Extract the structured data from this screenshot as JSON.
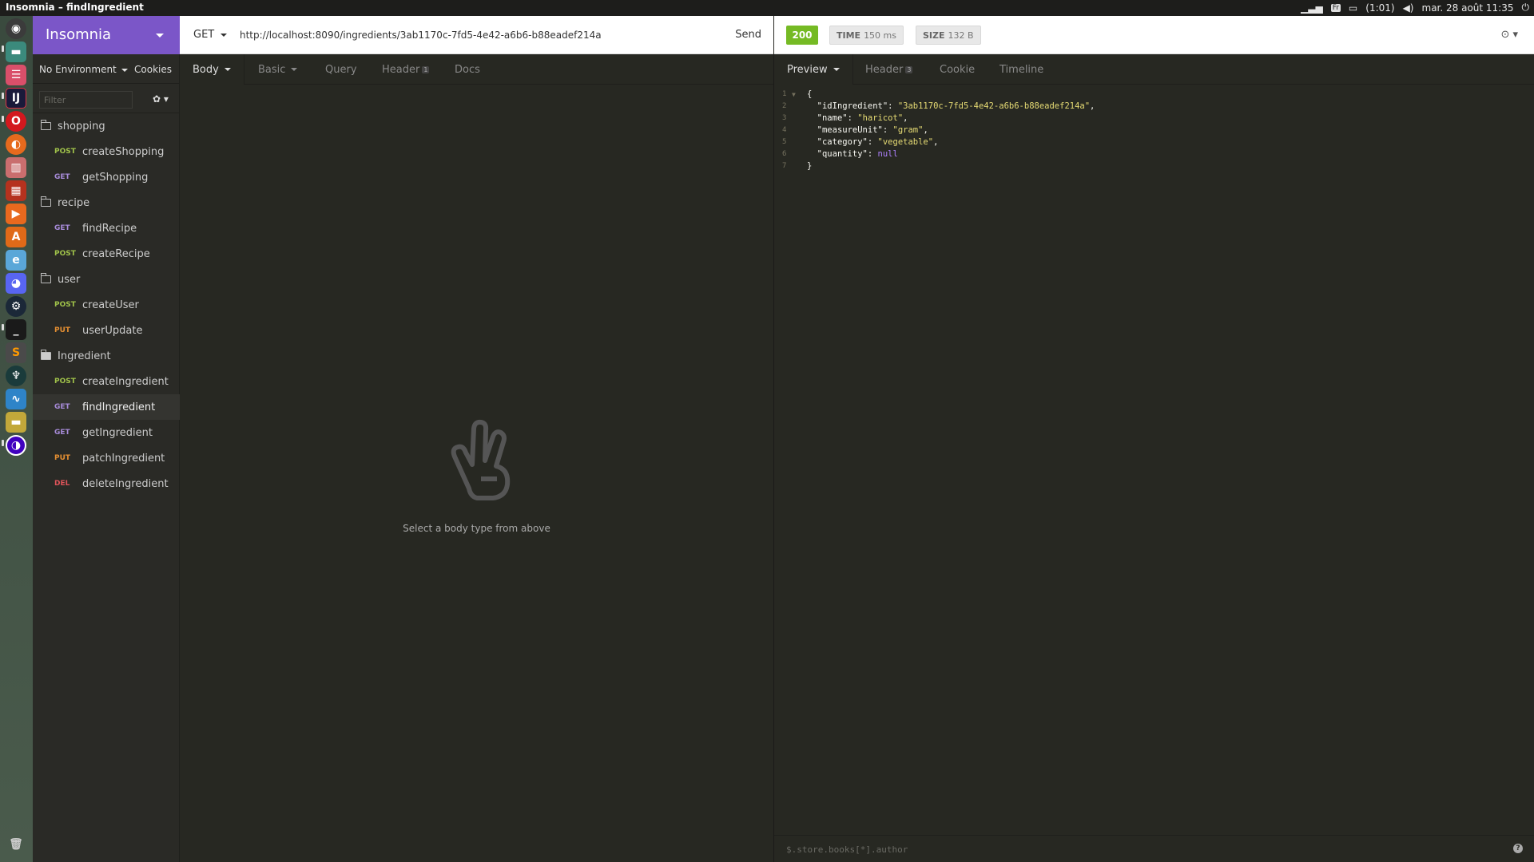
{
  "os": {
    "window_title": "Insomnia – findIngredient",
    "keyboard_layout": "Fr",
    "battery": "(1:01)",
    "datetime": "mar. 28 août 11:35"
  },
  "workspace": {
    "name": "Insomnia",
    "environment": "No Environment",
    "cookies_label": "Cookies",
    "filter_placeholder": "Filter"
  },
  "sidebar": {
    "groups": [
      {
        "name": "shopping",
        "items": [
          {
            "method": "POST",
            "name": "createShopping"
          },
          {
            "method": "GET",
            "name": "getShopping"
          }
        ]
      },
      {
        "name": "recipe",
        "items": [
          {
            "method": "GET",
            "name": "findRecipe"
          },
          {
            "method": "POST",
            "name": "createRecipe"
          }
        ]
      },
      {
        "name": "user",
        "items": [
          {
            "method": "POST",
            "name": "createUser"
          },
          {
            "method": "PUT",
            "name": "userUpdate"
          }
        ]
      },
      {
        "name": "Ingredient",
        "items": [
          {
            "method": "POST",
            "name": "createIngredient"
          },
          {
            "method": "GET",
            "name": "findIngredient"
          },
          {
            "method": "GET",
            "name": "getIngredient"
          },
          {
            "method": "PUT",
            "name": "patchIngredient"
          },
          {
            "method": "DEL",
            "name": "deleteIngredient"
          }
        ]
      }
    ]
  },
  "request": {
    "method": "GET",
    "url": "http://localhost:8090/ingredients/3ab1170c-7fd5-4e42-a6b6-b88eadef214a",
    "send_label": "Send",
    "tabs": {
      "body": "Body",
      "auth": "Basic",
      "query": "Query",
      "header": "Header",
      "header_count": "1",
      "docs": "Docs"
    },
    "empty_message": "Select a body type from above"
  },
  "response": {
    "status": "200",
    "time_label": "TIME",
    "time_value": "150 ms",
    "size_label": "SIZE",
    "size_value": "132 B",
    "tabs": {
      "preview": "Preview",
      "header": "Header",
      "header_count": "3",
      "cookie": "Cookie",
      "timeline": "Timeline"
    },
    "lines": [
      {
        "num": "1",
        "text": "{"
      },
      {
        "num": "2",
        "key": "\"idIngredient\"",
        "value": "\"3ab1170c-7fd5-4e42-a6b6-b88eadef214a\"",
        "trail": ","
      },
      {
        "num": "3",
        "key": "\"name\"",
        "value": "\"haricot\"",
        "trail": ","
      },
      {
        "num": "4",
        "key": "\"measureUnit\"",
        "value": "\"gram\"",
        "trail": ","
      },
      {
        "num": "5",
        "key": "\"category\"",
        "value": "\"vegetable\"",
        "trail": ","
      },
      {
        "num": "6",
        "key": "\"quantity\"",
        "value": "null",
        "trail": ""
      },
      {
        "num": "7",
        "text": "}"
      }
    ],
    "filter_placeholder": "$.store.books[*].author"
  },
  "colors": {
    "accent": "#7b56c8",
    "status_ok": "#75ba24",
    "post": "#a0c24a",
    "get": "#a78bd9",
    "put": "#e38e32",
    "delete": "#e0545a"
  }
}
